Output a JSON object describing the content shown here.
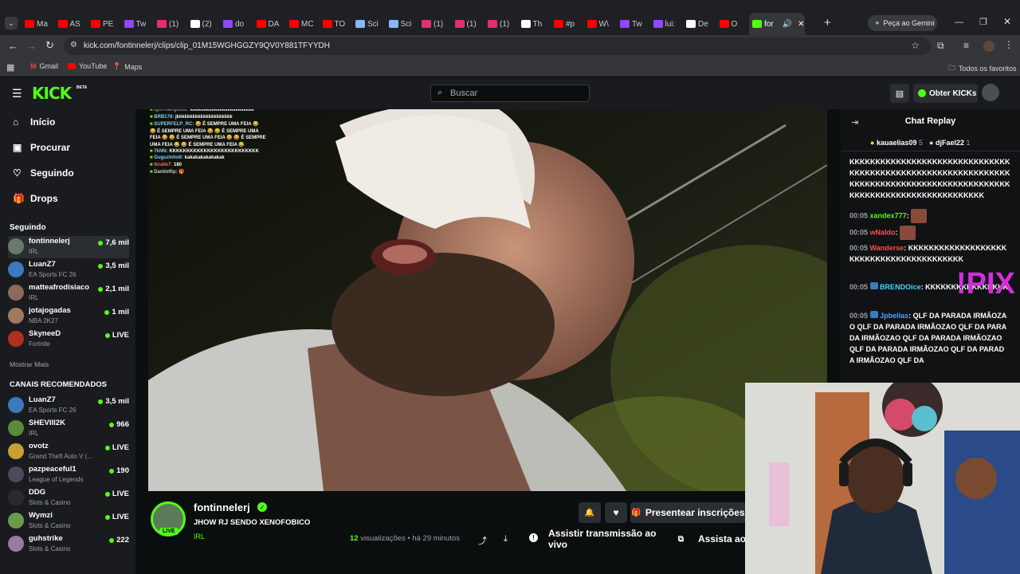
{
  "browser": {
    "tabs": [
      {
        "label": "Ma",
        "color": "#ff0000"
      },
      {
        "label": "AS",
        "color": "#ff0000"
      },
      {
        "label": "PE",
        "color": "#ff0000"
      },
      {
        "label": "Tw",
        "color": "#9146ff"
      },
      {
        "label": "(1)",
        "color": "#e1306c"
      },
      {
        "label": "(2)",
        "color": "#ffffff"
      },
      {
        "label": "do",
        "color": "#9146ff"
      },
      {
        "label": "DA",
        "color": "#ff0000"
      },
      {
        "label": "MC",
        "color": "#ff0000"
      },
      {
        "label": "TO",
        "color": "#ff0000"
      },
      {
        "label": "Sci",
        "color": "#8ab4f8"
      },
      {
        "label": "Sci",
        "color": "#8ab4f8"
      },
      {
        "label": "(1)",
        "color": "#e1306c"
      },
      {
        "label": "(1)",
        "color": "#e1306c"
      },
      {
        "label": "(1)",
        "color": "#e1306c"
      },
      {
        "label": "Th",
        "color": "#ffffff"
      },
      {
        "label": "#p",
        "color": "#ff0000"
      },
      {
        "label": "W\\",
        "color": "#ff0000"
      },
      {
        "label": "Tw",
        "color": "#9146ff"
      },
      {
        "label": "lui:",
        "color": "#9146ff"
      },
      {
        "label": "De",
        "color": "#ffffff"
      },
      {
        "label": "O",
        "color": "#ff0000"
      },
      {
        "label": "for",
        "color": "#53fc18"
      }
    ],
    "new_tab": "+",
    "gemini_label": "Peça ao Gemini",
    "url": "kick.com/fontinnelerj/clips/clip_01M15WGHGGZY9QV0Y881TFYYDH",
    "bookmarks": [
      "Gmail",
      "YouTube",
      "Maps"
    ],
    "all_favorites": "Todos os favoritos"
  },
  "kick": {
    "logo": "KICK",
    "logo_badge": "BETA",
    "search_placeholder": "Buscar",
    "get_kicks": "Obter KICKs",
    "nav": [
      {
        "label": "Início",
        "icon": "home-icon"
      },
      {
        "label": "Procurar",
        "icon": "browse-icon"
      },
      {
        "label": "Seguindo",
        "icon": "heart-icon"
      },
      {
        "label": "Drops",
        "icon": "gift-icon"
      }
    ],
    "following_title": "Seguindo",
    "following": [
      {
        "name": "fontinnelerj",
        "category": "IRL",
        "viewers": "7,6 mil",
        "color": "#6a7a6a"
      },
      {
        "name": "LuanZ7",
        "category": "EA Sports FC 26",
        "viewers": "3,5 mil",
        "color": "#3a7abd"
      },
      {
        "name": "matteafrodisiaco",
        "category": "IRL",
        "viewers": "2,1 mil",
        "color": "#8a6a5a"
      },
      {
        "name": "jotajogadas",
        "category": "NBA 2K27",
        "viewers": "1 mil",
        "color": "#a07a60"
      },
      {
        "name": "SkyneeD",
        "category": "Fortnite",
        "viewers": "LIVE",
        "color": "#b03020"
      }
    ],
    "show_more": "Mostrar Mais",
    "recommended_title": "CANAIS RECOMENDADOS",
    "recommended": [
      {
        "name": "LuanZ7",
        "category": "EA Sports FC 26",
        "viewers": "3,5 mil",
        "color": "#3a7abd"
      },
      {
        "name": "SHEVIII2K",
        "category": "IRL",
        "viewers": "966",
        "color": "#5a8a3a"
      },
      {
        "name": "ovotz",
        "category": "Grand Theft Auto V (...",
        "viewers": "LIVE",
        "color": "#c8a030"
      },
      {
        "name": "pazpeaceful1",
        "category": "League of Legends",
        "viewers": "190",
        "color": "#4a4a5a"
      },
      {
        "name": "DDG",
        "category": "Slots & Casino",
        "viewers": "LIVE",
        "color": "#2a2a2a"
      },
      {
        "name": "Wymzi",
        "category": "Slots & Casino",
        "viewers": "LIVE",
        "color": "#6a9a4a"
      },
      {
        "name": "guhstrike",
        "category": "Slots & Casino",
        "viewers": "222",
        "color": "#9a7aa0"
      }
    ],
    "overlay_chat": [
      {
        "user": "igorroariguesz:",
        "text": "kkkkkkkkkkkkkkkkkkkkkkkk",
        "color": "#888888"
      },
      {
        "user": "BRB178:",
        "text": "jkkkkkkkkkkkkkkkkkkkkk",
        "color": "#7fd0ff"
      },
      {
        "user": "SUPERFELP_RC:",
        "text": "😂 É SEMPRE UMA FEIA 😂",
        "color": "#7fd0ff"
      },
      {
        "user": "",
        "text": "😂 É SEMPRE UMA FEIA 😂 😂 É SEMPRE UMA",
        "color": "#ffffff"
      },
      {
        "user": "",
        "text": "FEIA 😂 😂 É SEMPRE UMA FEIA 😂 😂 É SEMPRE",
        "color": "#ffffff"
      },
      {
        "user": "",
        "text": "UMA FEIA 😂 😂 É SEMPRE UMA FEIA 😂",
        "color": "#ffffff"
      },
      {
        "user": "7kNN:",
        "text": "KKKKKKKKKKKKKKKKKKKKKKKKKK",
        "color": "#7fd0ff"
      },
      {
        "user": "Guguzinho0:",
        "text": "kakakakakakakak",
        "color": "#7fd0ff"
      },
      {
        "user": "tkralie7:",
        "text": "180",
        "color": "#ff6a6a"
      },
      {
        "user": "Daniloflip:",
        "text": "🎁",
        "color": "#cccccc"
      }
    ],
    "clip": {
      "channel": "fontinnelerj",
      "live_badge": "LIVE",
      "title": "JHOW RJ SENDO XENOFOBICO",
      "category": "IRL",
      "views_count": "12",
      "views_label": "visualizações",
      "time_ago": "há 29 minutos",
      "present_subs": "Presentear inscrições",
      "watch_live": "Assistir transmissão ao vivo",
      "watch_cut": "Assista ao v"
    },
    "chat": {
      "title": "Chat Replay",
      "top_gifters": [
        {
          "name": "kauaelias09",
          "count": "5"
        },
        {
          "name": "djFael22",
          "count": "1"
        }
      ],
      "kk_block": [
        "KKKKKKKKKKKKKKKKKKKKKKKKKKKKKKK",
        "KKKKKKKKKKKKKKKKKKKKKKKKKKKKKKK",
        "KKKKKKKKKKKKKKKKKKKKKKKKKKKKKKK",
        "KKKKKKKKKKKKKKKKKKKKKKKKKK"
      ],
      "messages": [
        {
          "time": "00:05",
          "user": "xandex777",
          "color": "#53fc18",
          "text": ""
        },
        {
          "time": "00:05",
          "user": "wNaldo",
          "color": "#ff4d4d",
          "text": ""
        },
        {
          "time": "00:05",
          "user": "Wanderse",
          "color": "#ff4d4d",
          "text": "KKKKKKKKKKKKKKKKKKKKKKKKKKKKKKKKKKKKKKKKK"
        },
        {
          "time": "00:05",
          "user": "BRENDOice",
          "color": "#4dd0ff",
          "text": "KKKKKKKKKKKKKKKK"
        },
        {
          "time": "00:05",
          "user": "Jpbellas",
          "color": "#4da3ff",
          "text": "QLF DA PARADA IRMÃOZAO QLF DA PARADA IRMÃOZAO QLF DA PARADA IRMÃOZAO QLF DA PARADA IRMÃOZAO QLF DA PARADA IRMÃOZAO QLF DA PARADA IRMÃOZAO QLF DA"
        }
      ],
      "overlay_text": "!PIX"
    }
  }
}
